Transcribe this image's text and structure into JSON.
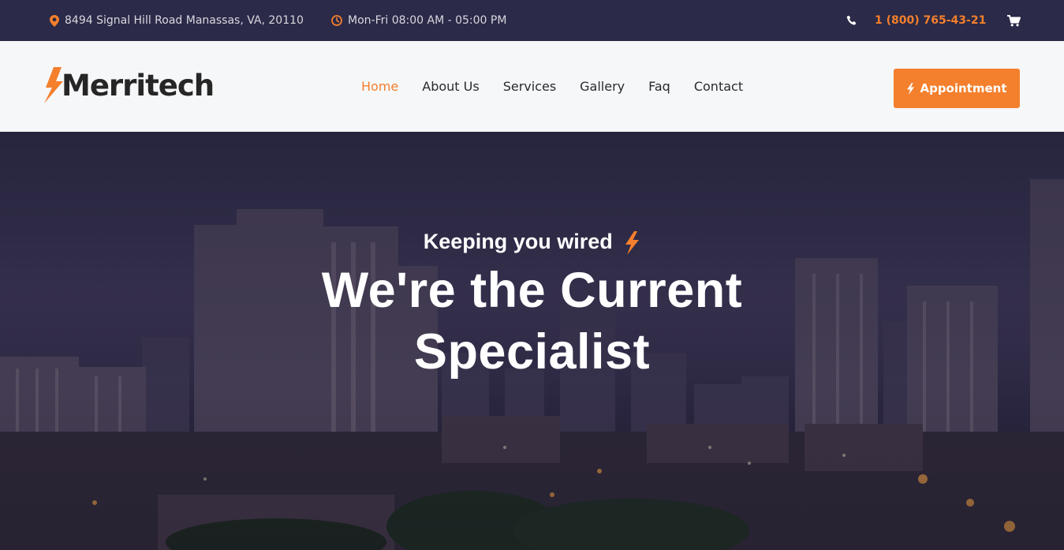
{
  "topbar": {
    "address": "8494 Signal Hill Road Manassas, VA, 20110",
    "hours": "Mon-Fri 08:00 AM - 05:00 PM",
    "phone": "1 (800) 765-43-21"
  },
  "header": {
    "logo_text": "Merritech",
    "nav": [
      "Home",
      "About Us",
      "Services",
      "Gallery",
      "Faq",
      "Contact"
    ],
    "active_nav": "Home",
    "appointment_label": "Appointment"
  },
  "hero": {
    "subtitle": "Keeping you wired",
    "title_line1": "We're the Current",
    "title_line2": "Specialist"
  },
  "colors": {
    "accent": "#f47f2c",
    "topbar_bg": "#2b2a48",
    "header_bg": "#f6f7f9"
  },
  "icons": [
    "map-pin-icon",
    "clock-icon",
    "phone-icon",
    "cart-icon",
    "bolt-icon"
  ]
}
